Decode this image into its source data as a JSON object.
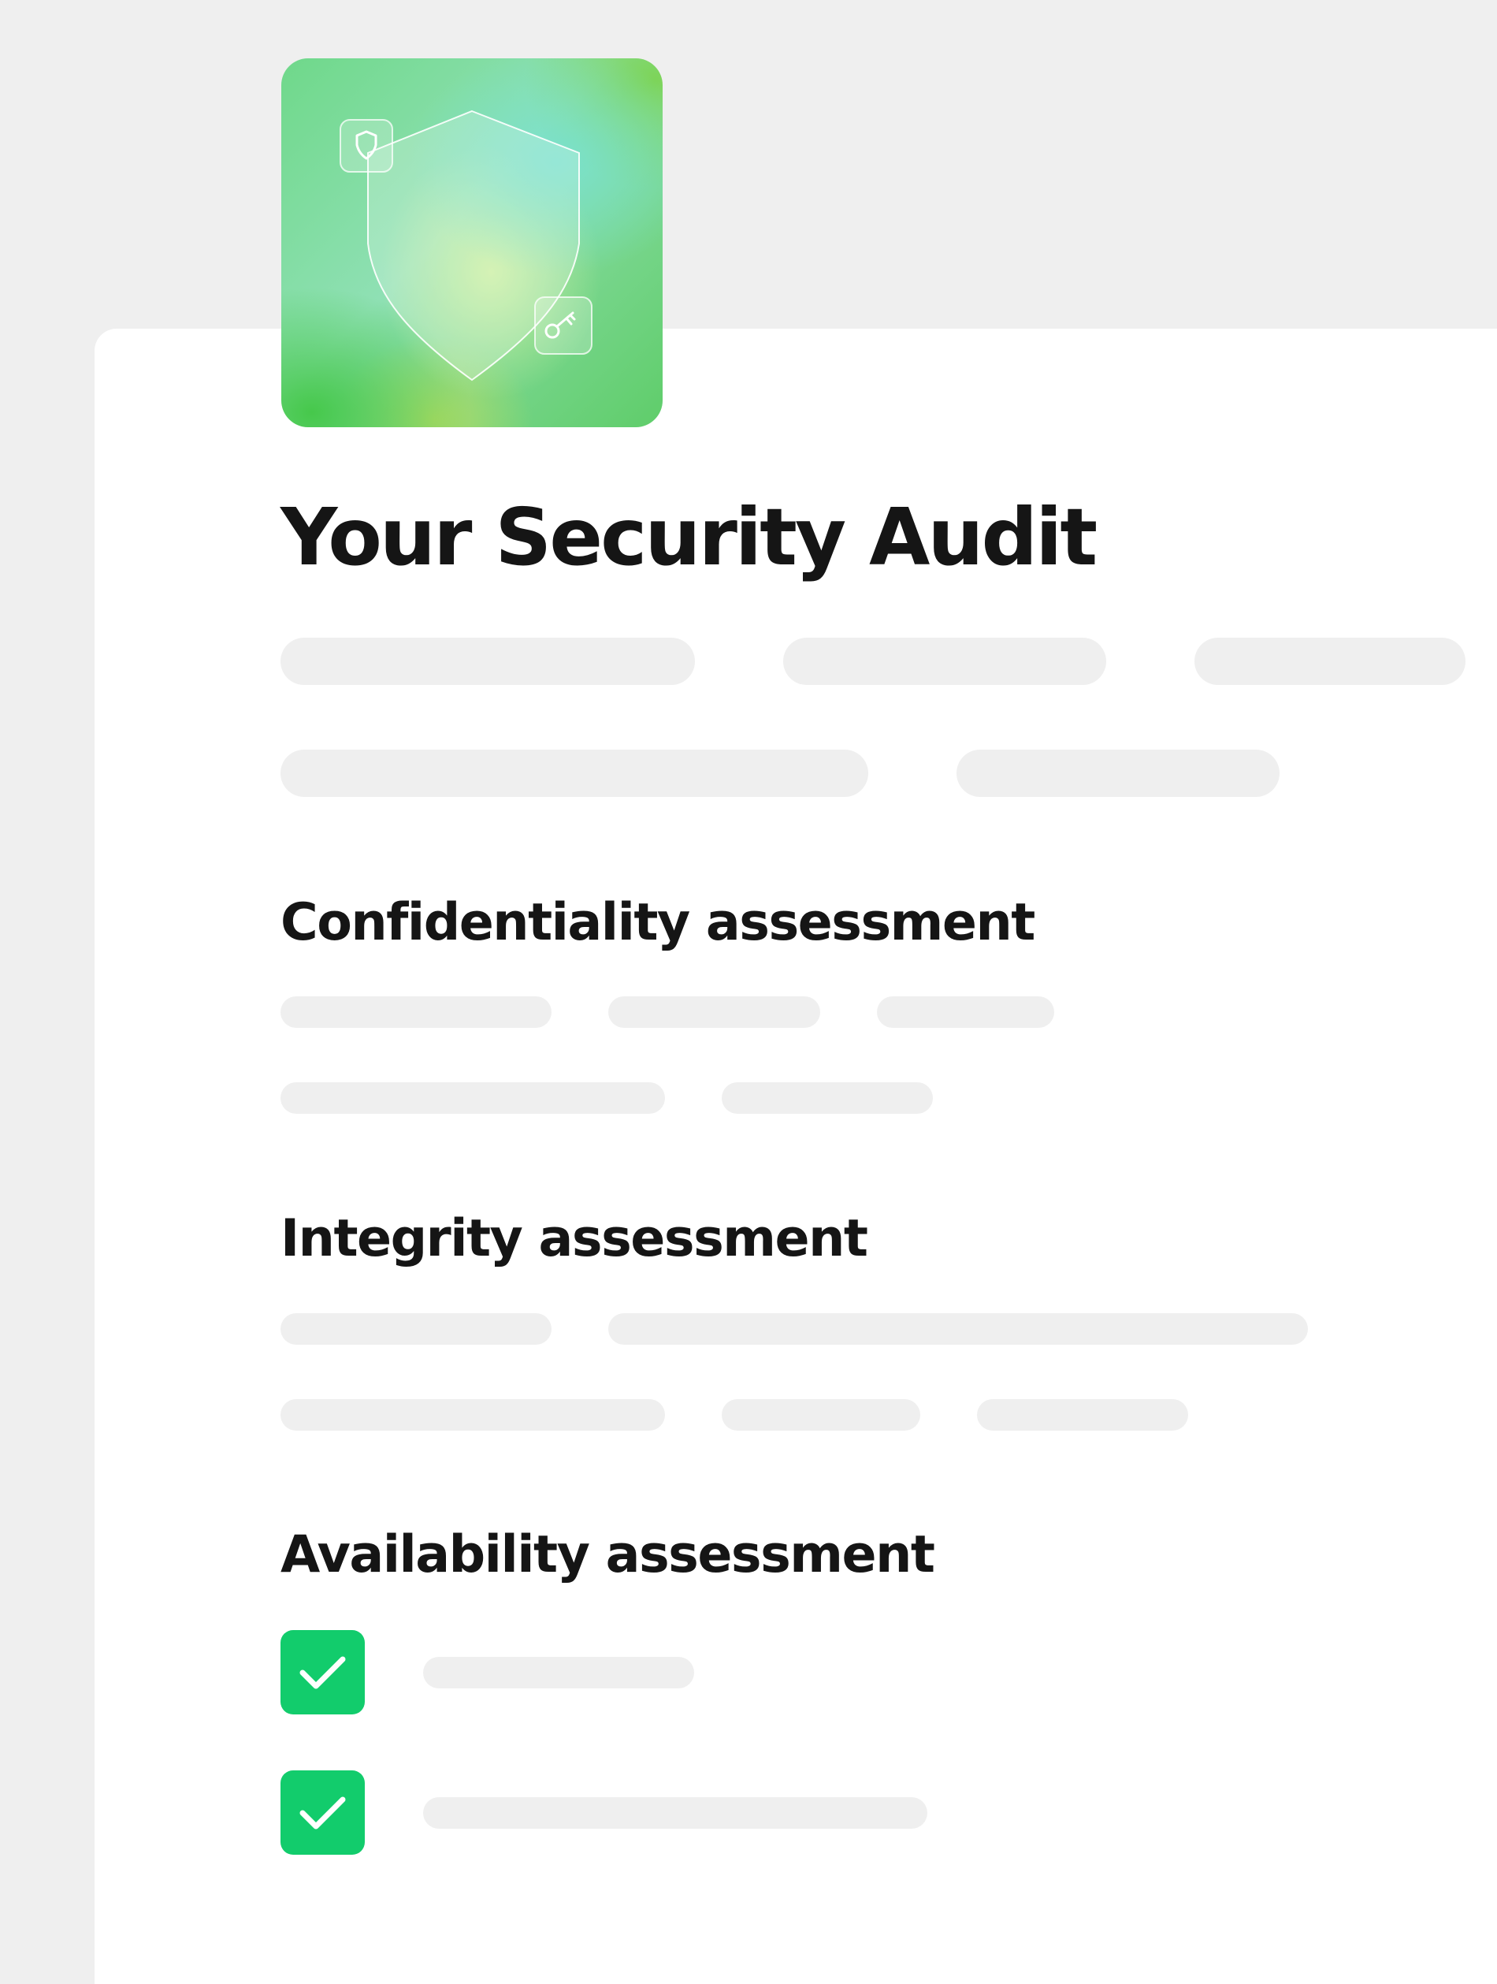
{
  "document": {
    "title": "Your Security Audit",
    "sections": [
      {
        "heading": "Confidentiality assessment"
      },
      {
        "heading": "Integrity assessment"
      },
      {
        "heading": "Availability assessment"
      }
    ],
    "availability_checklist": [
      {
        "checked": true
      },
      {
        "checked": true
      }
    ]
  },
  "hero": {
    "icons": [
      "shield-icon",
      "key-icon"
    ]
  },
  "colors": {
    "background": "#efefef",
    "card": "#ffffff",
    "text": "#151515",
    "placeholder": "#efefef",
    "check": "#12cc6c"
  }
}
